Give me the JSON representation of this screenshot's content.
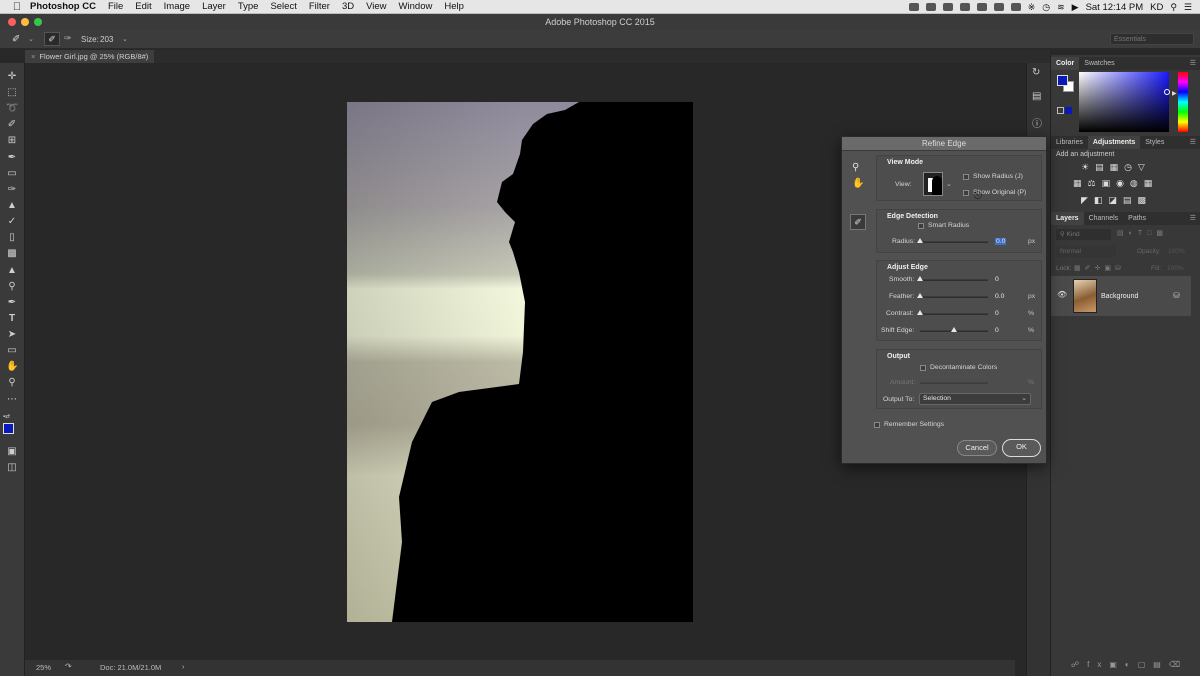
{
  "menubar": {
    "items": [
      "Photoshop CC",
      "File",
      "Edit",
      "Image",
      "Layer",
      "Type",
      "Select",
      "Filter",
      "3D",
      "View",
      "Window",
      "Help"
    ],
    "clock": "Sat 12:14 PM",
    "user": "KD"
  },
  "window": {
    "title": "Adobe Photoshop CC 2015"
  },
  "options": {
    "size_label": "Size:",
    "size_value": "203",
    "workspace": "Essentials"
  },
  "document": {
    "tab_title": "Flower Girl.jpg @ 25% (RGB/8#)"
  },
  "status": {
    "zoom": "25%",
    "doc": "Doc: 21.0M/21.0M"
  },
  "color_panel": {
    "tabs": [
      "Color",
      "Swatches"
    ],
    "active": "Color",
    "fg": "#0a1ab8",
    "bg": "#ffffff"
  },
  "adjustments_panel": {
    "tabs": [
      "Libraries",
      "Adjustments",
      "Styles"
    ],
    "active": "Adjustments",
    "hint": "Add an adjustment"
  },
  "layers_panel": {
    "tabs": [
      "Layers",
      "Channels",
      "Paths"
    ],
    "active": "Layers",
    "kind": "Kind",
    "blend": "Normal",
    "opacity_label": "Opacity:",
    "opacity": "100%",
    "lock_label": "Lock:",
    "fill_label": "Fill:",
    "fill": "100%",
    "layer_name": "Background"
  },
  "dialog": {
    "title": "Refine Edge",
    "view_mode": {
      "heading": "View Mode",
      "view_label": "View:",
      "show_radius": "Show Radius (J)",
      "show_original": "Show Original (P)"
    },
    "edge_detection": {
      "heading": "Edge Detection",
      "smart_radius": "Smart Radius",
      "radius_label": "Radius:",
      "radius_value": "0.0",
      "radius_unit": "px"
    },
    "adjust_edge": {
      "heading": "Adjust Edge",
      "smooth_label": "Smooth:",
      "smooth": "0",
      "feather_label": "Feather:",
      "feather": "0.0",
      "feather_unit": "px",
      "contrast_label": "Contrast:",
      "contrast": "0",
      "contrast_unit": "%",
      "shift_label": "Shift Edge:",
      "shift": "0",
      "shift_unit": "%"
    },
    "output": {
      "heading": "Output",
      "decontaminate": "Decontaminate Colors",
      "amount_label": "Amount:",
      "amount_unit": "%",
      "output_to_label": "Output To:",
      "output_to": "Selection"
    },
    "remember": "Remember Settings",
    "cancel": "Cancel",
    "ok": "OK"
  }
}
